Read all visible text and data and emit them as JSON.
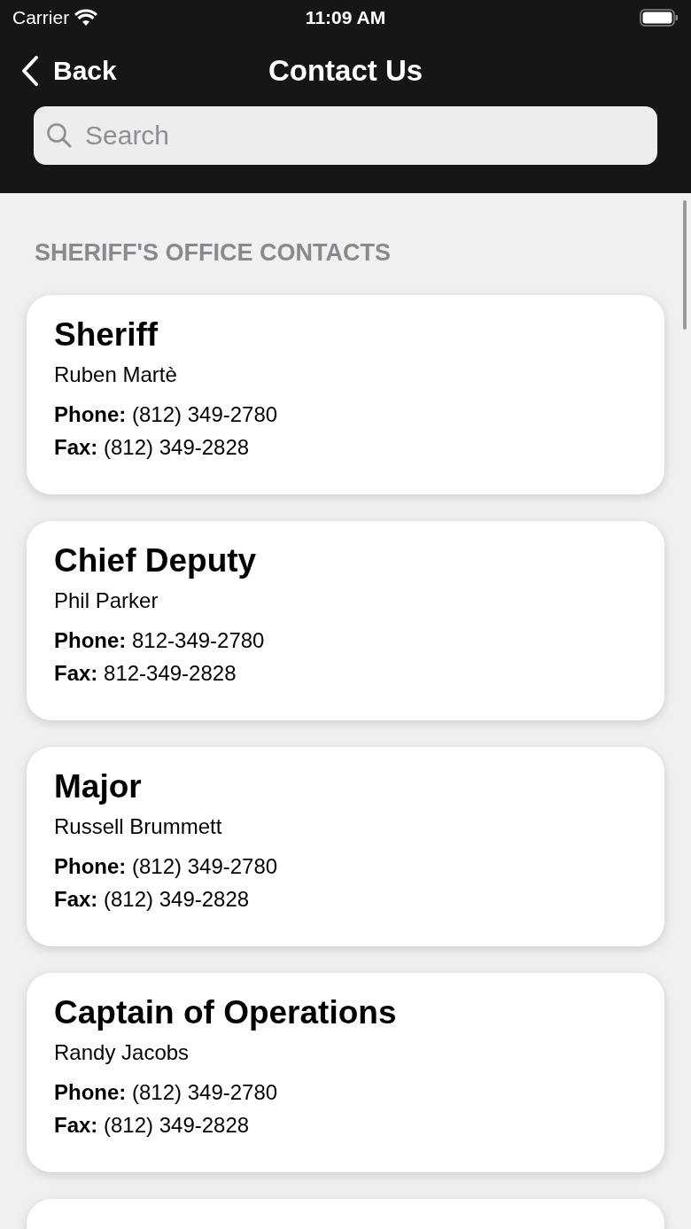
{
  "status_bar": {
    "carrier": "Carrier",
    "time": "11:09 AM"
  },
  "nav": {
    "back": "Back",
    "title": "Contact Us"
  },
  "search": {
    "placeholder": "Search"
  },
  "section": {
    "title": "SHERIFF'S OFFICE CONTACTS"
  },
  "contacts": [
    {
      "title": "Sheriff",
      "name": "Ruben Martè",
      "phone": "**Phone:** (812) 349-2780",
      "fax": "**Fax:** (812) 349-2828"
    },
    {
      "title": "Chief Deputy",
      "name": "Phil Parker",
      "phone": "**Phone:** 812-349-2780",
      "fax": "**Fax:** 812-349-2828"
    },
    {
      "title": "Major",
      "name": "Russell Brummett",
      "phone": "**Phone:** (812) 349-2780",
      "fax": "**Fax:** (812) 349-2828"
    },
    {
      "title": "Captain of Operations",
      "name": "Randy Jacobs",
      "phone": "**Phone:** (812) 349-2780",
      "fax": "**Fax:** (812) 349-2828"
    }
  ]
}
